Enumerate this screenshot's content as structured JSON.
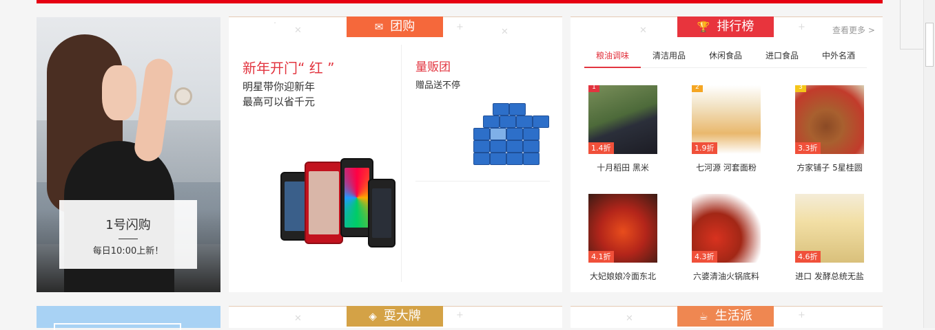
{
  "flash": {
    "title": "1号闪购",
    "subtitle": "每日10:00上新！"
  },
  "group": {
    "tag": "团购",
    "left_title": "新年开门“ 红 ”",
    "left_sub1": "明星带你迎新年",
    "left_sub2": "最高可以省千元",
    "right_title": "量贩团",
    "right_sub": "赠品送不停"
  },
  "ranking": {
    "tag": "排行榜",
    "more": "查看更多 >",
    "tabs": [
      "粮油调味",
      "清洁用品",
      "休闲食品",
      "进口食品",
      "中外名酒"
    ],
    "products": [
      {
        "rank": "1",
        "discount": "1.4折",
        "name": "十月稻田 黑米"
      },
      {
        "rank": "2",
        "discount": "1.9折",
        "name": "七河源 河套面粉"
      },
      {
        "rank": "3",
        "discount": "3.3折",
        "name": "方家铺子 5星桂圆"
      },
      {
        "rank": "",
        "discount": "4.1折",
        "name": "大妃娘娘冷面东北"
      },
      {
        "rank": "",
        "discount": "4.3折",
        "name": "六婆清油火锅底料"
      },
      {
        "rank": "",
        "discount": "4.6折",
        "name": "进口 发酵总统无盐"
      }
    ]
  },
  "bottom": {
    "tag1": "耍大牌",
    "tag2": "生活派"
  },
  "colors": {
    "accent": "#e60012",
    "tag_group": "#f5683b",
    "tag_rank": "#e8343d",
    "tag_brand": "#d4a246",
    "tag_life": "#ef8751"
  }
}
